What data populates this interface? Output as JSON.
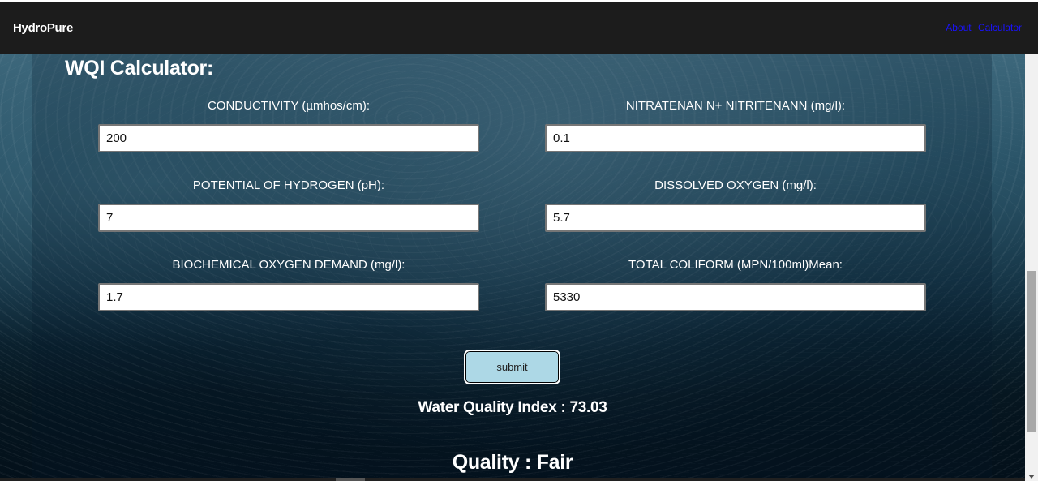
{
  "navbar": {
    "brand": "HydroPure",
    "links": [
      "About",
      "Calculator"
    ]
  },
  "main": {
    "heading": "WQI Calculator:",
    "fields": [
      {
        "label": "CONDUCTIVITY (µmhos/cm):",
        "value": "200"
      },
      {
        "label": "NITRATENAN N+ NITRITENANN (mg/l):",
        "value": "0.1"
      },
      {
        "label": "POTENTIAL OF HYDROGEN (pH):",
        "value": "7"
      },
      {
        "label": "DISSOLVED OXYGEN (mg/l):",
        "value": "5.7"
      },
      {
        "label": "BIOCHEMICAL OXYGEN DEMAND (mg/l):",
        "value": "1.7"
      },
      {
        "label": "TOTAL COLIFORM (MPN/100ml)Mean:",
        "value": "5330"
      }
    ],
    "submit_label": "submit",
    "result_text": "Water Quality Index : 73.03",
    "quality_text": "Quality : Fair"
  },
  "colors": {
    "navbar_bg": "#1c1c1c",
    "link": "#1a12ff",
    "submit_bg": "#add8e6"
  }
}
